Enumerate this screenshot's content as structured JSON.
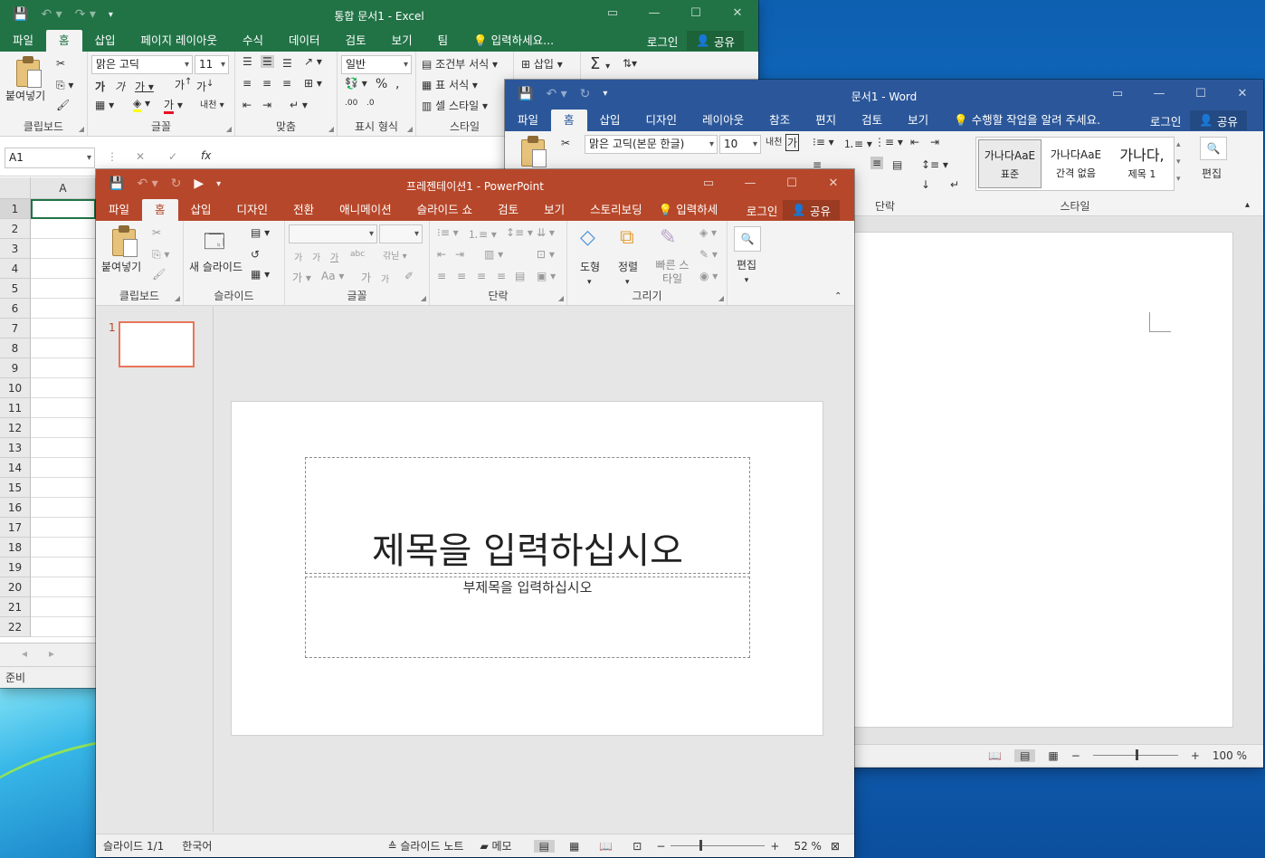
{
  "excel": {
    "title": "통합 문서1 - Excel",
    "tabs": [
      "파일",
      "홈",
      "삽입",
      "페이지 레이아웃",
      "수식",
      "데이터",
      "검토",
      "보기",
      "팀"
    ],
    "tell_me": "입력하세요...",
    "login": "로그인",
    "share": "공유",
    "font_name": "맑은 고딕",
    "font_size": "11",
    "number_format": "일반",
    "paste_label": "붙여넣기",
    "groups": [
      "클립보드",
      "글꼴",
      "맞춤",
      "표시 형식",
      "스타일"
    ],
    "style_items": [
      "조건부 서식",
      "표 서식",
      "셀 스타일"
    ],
    "insert_label": "삽입",
    "name_box": "A1",
    "fx": "fx",
    "column_a": "A",
    "rows": [
      "1",
      "2",
      "3",
      "4",
      "5",
      "6",
      "7",
      "8",
      "9",
      "10",
      "11",
      "12",
      "13",
      "14",
      "15",
      "16",
      "17",
      "18",
      "19",
      "20",
      "21",
      "22"
    ],
    "status": "준비"
  },
  "word": {
    "title": "문서1 - Word",
    "tabs": [
      "파일",
      "홈",
      "삽입",
      "디자인",
      "레이아웃",
      "참조",
      "편지",
      "검토",
      "보기"
    ],
    "tell_me": "수행할 작업을 알려 주세요.",
    "login": "로그인",
    "share": "공유",
    "font_name": "맑은 고딕(본문 한글)",
    "font_size": "10",
    "styles": [
      {
        "preview": "가나다AaE",
        "name": "표준"
      },
      {
        "preview": "가나다AaE",
        "name": "간격 없음"
      },
      {
        "preview": "가나다,",
        "name": "제목 1"
      }
    ],
    "groups": [
      "단락",
      "스타일"
    ],
    "edit_label": "편집",
    "zoom": "100 %"
  },
  "powerpoint": {
    "title": "프레젠테이션1 - PowerPoint",
    "tabs": [
      "파일",
      "홈",
      "삽입",
      "디자인",
      "전환",
      "애니메이션",
      "슬라이드 쇼",
      "검토",
      "보기",
      "스토리보딩"
    ],
    "tell_me": "입력하세",
    "login": "로그인",
    "share": "공유",
    "paste_label": "붙여넣기",
    "new_slide_label": "새 슬라이드",
    "shape_label": "도형",
    "arrange_label": "정렬",
    "quick_style_label": "빠른 스타일",
    "edit_label": "편집",
    "groups": [
      "클립보드",
      "슬라이드",
      "글꼴",
      "단락",
      "그리기"
    ],
    "thumb_number": "1",
    "slide_title": "제목을 입력하십시오",
    "slide_subtitle": "부제목을 입력하십시오",
    "status": {
      "slide": "슬라이드 1/1",
      "language": "한국어",
      "notes": "슬라이드 노트",
      "comments": "메모",
      "zoom": "52 %"
    },
    "accent": "#b7472a"
  },
  "colors": {
    "excel": "#217346",
    "word": "#2b579a",
    "powerpoint": "#b7472a"
  }
}
